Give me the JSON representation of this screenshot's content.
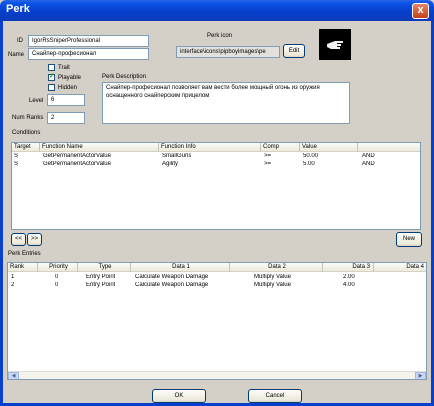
{
  "window": {
    "title": "Perk",
    "close_label": "x"
  },
  "form": {
    "id_label": "ID",
    "id_value": "IgorRsSniperProfessional",
    "name_label": "Name",
    "name_value": "Снайпер-професионал",
    "trait_label": "Trait",
    "trait_checked": false,
    "playable_label": "Playable",
    "playable_checked": true,
    "hidden_label": "Hidden",
    "hidden_checked": false,
    "level_label": "Level",
    "level_value": "6",
    "num_ranks_label": "Num Ranks",
    "num_ranks_value": "2",
    "perk_icon_label": "Perk icon",
    "perk_icon_path": "interface\\icons\\pipboyimages\\pe",
    "edit_button": "Edit",
    "perk_description_label": "Perk Description",
    "perk_description_text": "Снайпер-професионал позволяет вам вести более мощный огонь из оружия оснащенного снайперским прицелом"
  },
  "conditions": {
    "label": "Conditions",
    "columns": [
      "Target",
      "Function Name",
      "Function Info",
      "Comp",
      "Value",
      ""
    ],
    "rows": [
      [
        "S",
        "GetPermanentActorValue",
        "SmallGuns",
        ">=",
        "50.00",
        "AND"
      ],
      [
        "S",
        "GetPermanentActorValue",
        "Agility",
        ">=",
        "5.00",
        "AND"
      ]
    ],
    "prev_button": "<<",
    "next_button": ">>",
    "new_button": "New"
  },
  "entries": {
    "label": "Perk Entries",
    "columns": [
      "Rank",
      "Priority",
      "Type",
      "Data 1",
      "Data 2",
      "Data 3",
      "Data 4"
    ],
    "rows": [
      [
        "1",
        "0",
        "Entry Point",
        "Calculate Weapon Damage",
        "Multiply Value",
        "2.00",
        ""
      ],
      [
        "2",
        "0",
        "Entry Point",
        "Calculate Weapon Damage",
        "Multiply Value",
        "4.00",
        ""
      ]
    ]
  },
  "footer": {
    "ok_button": "OK",
    "cancel_button": "Cancel"
  },
  "colors": {
    "titlebar": "#0840cc",
    "accent_check": "#21a121"
  }
}
